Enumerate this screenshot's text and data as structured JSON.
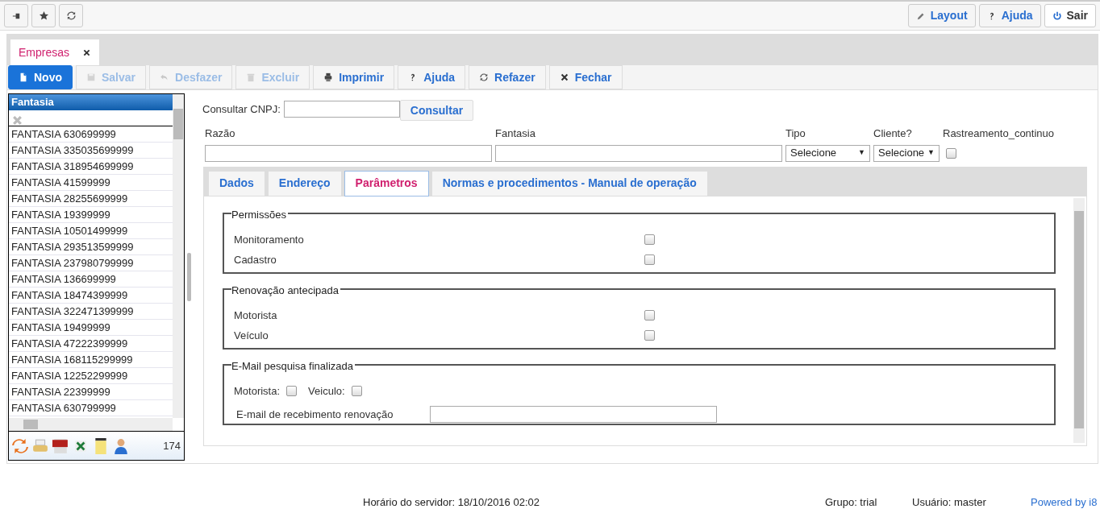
{
  "top_toolbar": {
    "icon_buttons": [
      {
        "kind": "pin"
      },
      {
        "kind": "star"
      },
      {
        "kind": "refresh"
      }
    ],
    "right_buttons": [
      {
        "label": "Layout",
        "kind": "pencil"
      },
      {
        "label": "Ajuda",
        "kind": "help"
      },
      {
        "label": "Sair",
        "kind": "power"
      }
    ]
  },
  "doc_tabs": [
    {
      "label": "Empresas",
      "selected": true
    }
  ],
  "actions": [
    {
      "label": "Novo",
      "kind": "file",
      "primary": true,
      "disabled": false
    },
    {
      "label": "Salvar",
      "kind": "save",
      "primary": false,
      "disabled": true
    },
    {
      "label": "Desfazer",
      "kind": "undo",
      "primary": false,
      "disabled": true
    },
    {
      "label": "Excluir",
      "kind": "trash",
      "primary": false,
      "disabled": true
    },
    {
      "label": "Imprimir",
      "kind": "print",
      "primary": false,
      "disabled": false
    },
    {
      "label": "Ajuda",
      "kind": "help",
      "primary": false,
      "disabled": false
    },
    {
      "label": "Refazer",
      "kind": "refresh",
      "primary": false,
      "disabled": false
    },
    {
      "label": "Fechar",
      "kind": "close",
      "primary": false,
      "disabled": false
    }
  ],
  "list": {
    "header": "Fantasia",
    "count": "174",
    "items": [
      "FANTASIA 630699999",
      "FANTASIA 335035699999",
      "FANTASIA 318954699999",
      "FANTASIA 41599999",
      "FANTASIA 28255699999",
      "FANTASIA 19399999",
      "FANTASIA 10501499999",
      "FANTASIA 293513599999",
      "FANTASIA 237980799999",
      "FANTASIA 136699999",
      "FANTASIA 18474399999",
      "FANTASIA 322471399999",
      "FANTASIA 19499999",
      "FANTASIA 47222399999",
      "FANTASIA 168115299999",
      "FANTASIA 12252299999",
      "FANTASIA 22399999",
      "FANTASIA 630799999"
    ],
    "tools": [
      {
        "kind": "refresh"
      },
      {
        "kind": "print"
      },
      {
        "kind": "pdf"
      },
      {
        "kind": "excel"
      },
      {
        "kind": "note"
      },
      {
        "kind": "user"
      }
    ]
  },
  "form": {
    "cnpj_label": "Consultar CNPJ:",
    "cnpj_button": "Consultar",
    "fields": [
      {
        "label": "Razão",
        "kind": "text"
      },
      {
        "label": "Fantasia",
        "kind": "text"
      },
      {
        "label": "Tipo",
        "kind": "select",
        "value": "Selecione",
        "arrow": "▼"
      },
      {
        "label": "Cliente?",
        "kind": "select",
        "value": "Selecione",
        "arrow": "▼"
      },
      {
        "label": "Rastreamento_continuo",
        "kind": "checkbox",
        "checked": false
      }
    ]
  },
  "tabs": [
    {
      "label": "Dados",
      "selected": false
    },
    {
      "label": "Endereço",
      "selected": false
    },
    {
      "label": "Parâmetros",
      "selected": true
    },
    {
      "label": "Normas e procedimentos - Manual de operação",
      "selected": false
    }
  ],
  "groups": [
    {
      "legend": "Permissões",
      "kind": "rows",
      "items": [
        {
          "label": "Monitoramento",
          "checked": false
        },
        {
          "label": "Cadastro",
          "checked": false
        }
      ]
    },
    {
      "legend": "Renovação antecipada",
      "kind": "rows",
      "items": [
        {
          "label": "Motorista",
          "checked": false
        },
        {
          "label": "Veículo",
          "checked": false
        }
      ]
    },
    {
      "legend": "E-Mail pesquisa finalizada",
      "kind": "inline",
      "items": [
        {
          "label": "Motorista:",
          "checked": false
        },
        {
          "label": "Veiculo:",
          "checked": false
        }
      ],
      "field_label": "E-mail de recebimento renovação"
    }
  ],
  "status_bar": {
    "server_time": "Horário do servidor: 18/10/2016 02:02",
    "group": "Grupo: trial",
    "user": "Usuário: master",
    "powered": "Powered by i8"
  }
}
